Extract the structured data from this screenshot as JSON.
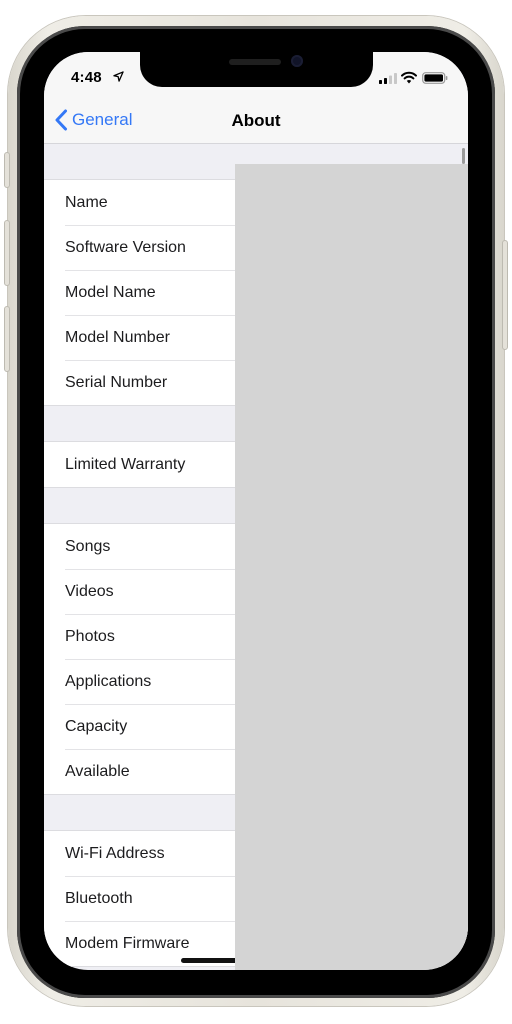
{
  "status_bar": {
    "time": "4:48",
    "icons": [
      "location-arrow-icon",
      "cellular-signal-icon",
      "wifi-icon",
      "battery-icon"
    ]
  },
  "nav": {
    "back_label": "General",
    "back_icon": "chevron-left-icon",
    "title": "About"
  },
  "colors": {
    "accent": "#3478f6",
    "background": "#efeff4",
    "cell": "#ffffff",
    "overlay": "#d4d4d4"
  },
  "sections": [
    {
      "rows": [
        {
          "label": "Name"
        },
        {
          "label": "Software Version"
        },
        {
          "label": "Model Name"
        },
        {
          "label": "Model Number"
        },
        {
          "label": "Serial Number"
        }
      ]
    },
    {
      "rows": [
        {
          "label": "Limited Warranty"
        }
      ]
    },
    {
      "rows": [
        {
          "label": "Songs"
        },
        {
          "label": "Videos"
        },
        {
          "label": "Photos"
        },
        {
          "label": "Applications"
        },
        {
          "label": "Capacity"
        },
        {
          "label": "Available"
        }
      ]
    },
    {
      "rows": [
        {
          "label": "Wi-Fi Address"
        },
        {
          "label": "Bluetooth"
        },
        {
          "label": "Modem Firmware"
        }
      ]
    }
  ]
}
